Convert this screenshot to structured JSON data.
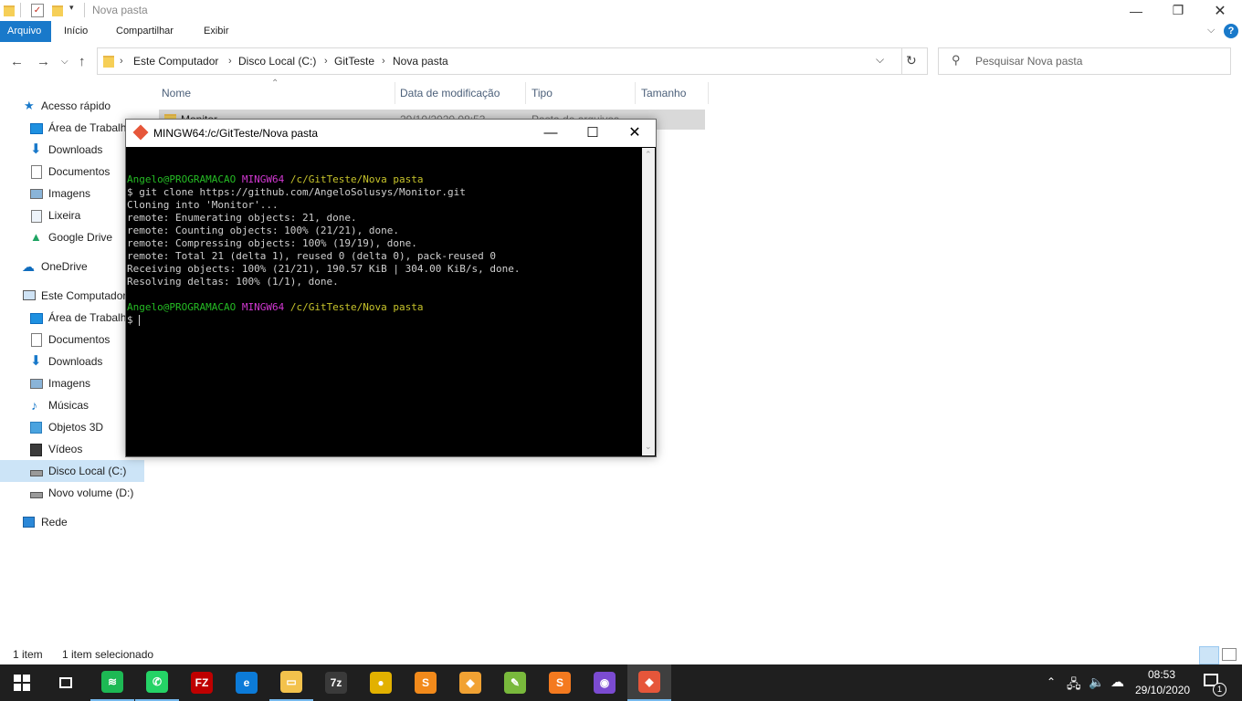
{
  "explorer": {
    "title": "Nova pasta",
    "ribbon_tabs": [
      "Arquivo",
      "Início",
      "Compartilhar",
      "Exibir"
    ],
    "help": "?",
    "breadcrumb": [
      "Este Computador",
      "Disco Local (C:)",
      "GitTeste",
      "Nova pasta"
    ],
    "search_placeholder": "Pesquisar Nova pasta",
    "nav_items": [
      {
        "label": "Acesso rápido",
        "icon": "star-icon"
      },
      {
        "label": "Área de Trabalho",
        "icon": "desktop-icon"
      },
      {
        "label": "Downloads",
        "icon": "download-icon"
      },
      {
        "label": "Documentos",
        "icon": "document-icon"
      },
      {
        "label": "Imagens",
        "icon": "pictures-icon"
      },
      {
        "label": "Lixeira",
        "icon": "recycle-bin-icon"
      },
      {
        "label": "Google Drive",
        "icon": "google-drive-icon"
      },
      {
        "label": "OneDrive",
        "icon": "cloud-icon"
      },
      {
        "label": "Este Computador",
        "icon": "computer-icon"
      },
      {
        "label": "Área de Trabalho",
        "icon": "desktop-icon"
      },
      {
        "label": "Documentos",
        "icon": "document-icon"
      },
      {
        "label": "Downloads",
        "icon": "download-icon"
      },
      {
        "label": "Imagens",
        "icon": "pictures-icon"
      },
      {
        "label": "Músicas",
        "icon": "music-icon"
      },
      {
        "label": "Objetos 3D",
        "icon": "cube-icon"
      },
      {
        "label": "Vídeos",
        "icon": "video-icon"
      },
      {
        "label": "Disco Local (C:)",
        "icon": "drive-icon"
      },
      {
        "label": "Novo volume (D:)",
        "icon": "drive-icon"
      },
      {
        "label": "Rede",
        "icon": "network-icon"
      }
    ],
    "columns": [
      "Nome",
      "Data de modificação",
      "Tipo",
      "Tamanho"
    ],
    "rows": [
      {
        "name": "Monitor",
        "date": "29/10/2020 08:53",
        "type": "Pasta de arquivos",
        "size": ""
      }
    ],
    "status": {
      "count": "1 item",
      "selected": "1 item selecionado"
    }
  },
  "terminal": {
    "title": "MINGW64:/c/GitTeste/Nova pasta",
    "prompt_user": "Angelo@PROGRAMACAO",
    "prompt_shell": "MINGW64",
    "prompt_path": "/c/GitTeste/Nova pasta",
    "command": "$ git clone https://github.com/AngeloSolusys/Monitor.git",
    "output": [
      "Cloning into 'Monitor'...",
      "remote: Enumerating objects: 21, done.",
      "remote: Counting objects: 100% (21/21), done.",
      "remote: Compressing objects: 100% (19/19), done.",
      "remote: Total 21 (delta 1), reused 0 (delta 0), pack-reused 0",
      "Receiving objects: 100% (21/21), 190.57 KiB | 304.00 KiB/s, done.",
      "Resolving deltas: 100% (1/1), done."
    ],
    "prompt_symbol": "$ "
  },
  "taskbar": {
    "apps": [
      {
        "name": "spotify-icon",
        "color": "#1db954",
        "glyph": "≋"
      },
      {
        "name": "whatsapp-icon",
        "color": "#25d366",
        "glyph": "✆"
      },
      {
        "name": "filezilla-icon",
        "color": "#bf0000",
        "glyph": "FZ"
      },
      {
        "name": "edge-icon",
        "color": "#0c7bd8",
        "glyph": "e"
      },
      {
        "name": "file-explorer-icon",
        "color": "#f3c24c",
        "glyph": "▭"
      },
      {
        "name": "7zip-icon",
        "color": "#3a3a3a",
        "glyph": "7z"
      },
      {
        "name": "app-yellow-icon",
        "color": "#e2b100",
        "glyph": "●"
      },
      {
        "name": "sublime-icon",
        "color": "#f28a1b",
        "glyph": "S"
      },
      {
        "name": "app-orange-icon",
        "color": "#f1a233",
        "glyph": "◆"
      },
      {
        "name": "notepad-plus-icon",
        "color": "#79b93c",
        "glyph": "✎"
      },
      {
        "name": "app-sync-icon",
        "color": "#f47a1f",
        "glyph": "S"
      },
      {
        "name": "github-desktop-icon",
        "color": "#7b4bd1",
        "glyph": "◉"
      },
      {
        "name": "git-bash-icon",
        "color": "#e6563a",
        "glyph": "◆"
      }
    ],
    "time": "08:53",
    "date": "29/10/2020",
    "notification_count": "1"
  }
}
